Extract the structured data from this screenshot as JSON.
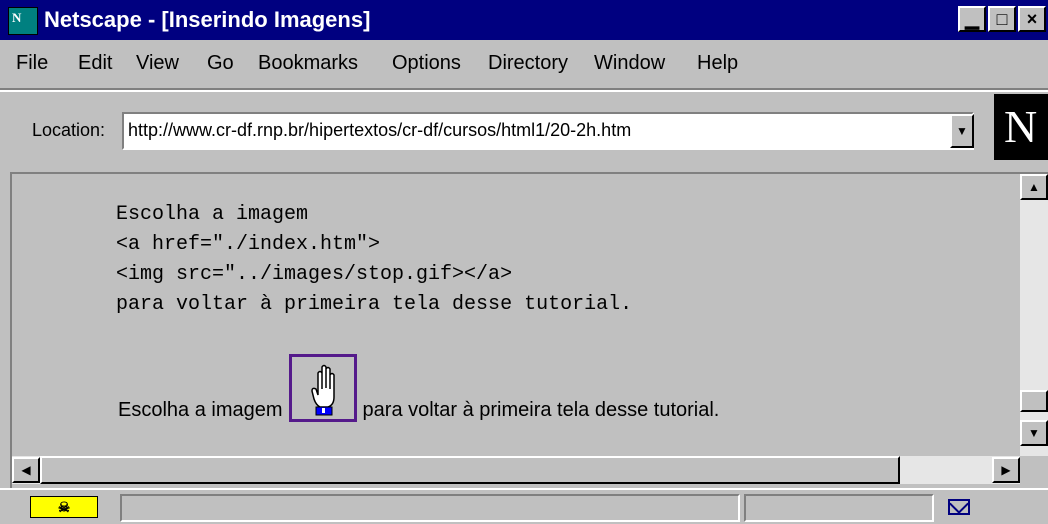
{
  "window": {
    "title": "Netscape - [Inserindo Imagens]",
    "app_icon_text": "N",
    "minimize_label": "▁",
    "maximize_label": "□",
    "close_label": "×"
  },
  "menu": {
    "items": [
      "File",
      "Edit",
      "View",
      "Go",
      "Bookmarks",
      "Options",
      "Directory",
      "Window",
      "Help"
    ]
  },
  "location": {
    "label": "Location:",
    "url": "http://www.cr-df.rnp.br/hipertextos/cr-df/cursos/html1/20-2h.htm",
    "dropdown_icon": "chevron-down-icon",
    "logo_text": "N"
  },
  "content": {
    "code_lines": [
      "Escolha a imagem",
      "<a href=\"./index.htm\">",
      "<img src=\"../images/stop.gif></a>",
      "para voltar à primeira tela desse tutorial."
    ],
    "rendered_before": "Escolha a imagem",
    "rendered_after": "para voltar à primeira tela desse tutorial.",
    "link_image_icon": "stop-hand-icon",
    "link_border_color": "#551a8b"
  },
  "scrollbars": {
    "vertical_up_icon": "arrow-up-icon",
    "vertical_down_icon": "arrow-down-icon",
    "horizontal_left_icon": "arrow-left-icon",
    "horizontal_right_icon": "arrow-right-icon"
  },
  "status": {
    "security_icon": "security-key-icon",
    "security_text": "☠",
    "text": "",
    "mail_icon": "mail-icon"
  },
  "colors": {
    "titlebar": "#000080",
    "chrome": "#c0c0c0"
  }
}
